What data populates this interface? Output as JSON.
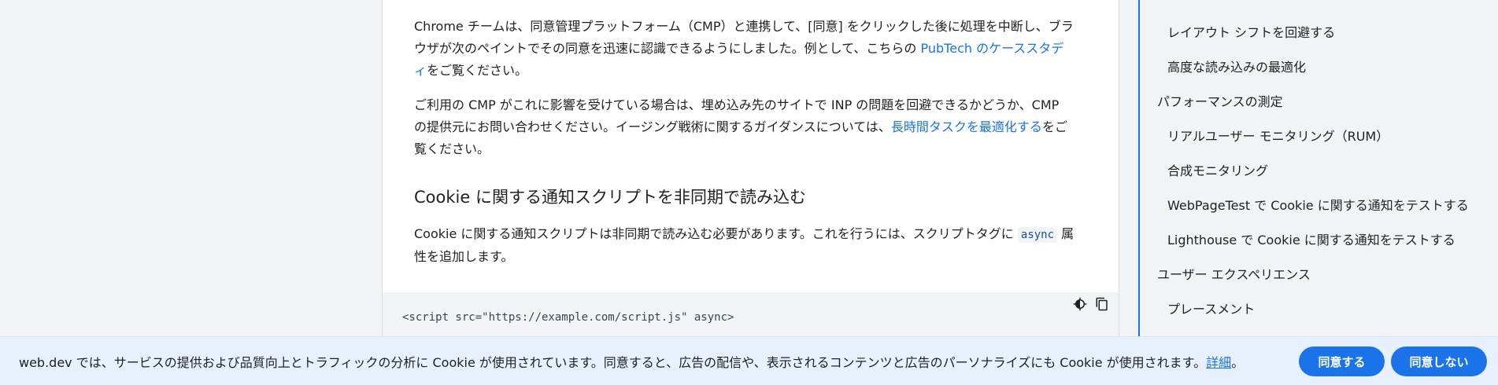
{
  "article": {
    "p1": {
      "text_before": "Chrome チームは、同意管理プラットフォーム（CMP）と連携して、[同意] をクリックした後に処理を中断し、ブラウザが次のペイントでその同意を迅速に認識できるようにしました。例として、こちらの ",
      "link": "PubTech のケーススタディ",
      "text_after": "をご覧ください。"
    },
    "p2": {
      "text_before": "ご利用の CMP がこれに影響を受けている場合は、埋め込み先のサイトで INP の問題を回避できるかどうか、CMP の提供元にお問い合わせください。イージング戦術に関するガイダンスについては、",
      "link": "長時間タスクを最適化する",
      "text_after": "をご覧ください。"
    },
    "heading": "Cookie に関する通知スクリプトを非同期で読み込む",
    "p3": {
      "text_before": "Cookie に関する通知スクリプトは非同期で読み込む必要があります。これを行うには、スクリプトタグに ",
      "code": "async",
      "text_after": " 属性を追加します。"
    },
    "code_block": {
      "line": "<script src=\"https://example.com/script.js\" async>",
      "icons": [
        "dark-theme-icon",
        "copy-icon"
      ]
    }
  },
  "toc": {
    "items": [
      {
        "label": "レイアウト シフトを回避する",
        "level": 2
      },
      {
        "label": "高度な読み込みの最適化",
        "level": 2
      },
      {
        "label": "パフォーマンスの測定",
        "level": 1
      },
      {
        "label": "リアルユーザー モニタリング（RUM）",
        "level": 2
      },
      {
        "label": "合成モニタリング",
        "level": 2
      },
      {
        "label": "WebPageTest で Cookie に関する通知をテストする",
        "level": 2
      },
      {
        "label": "Lighthouse で Cookie に関する通知をテストする",
        "level": 2
      },
      {
        "label": "ユーザー エクスペリエンス",
        "level": 1
      },
      {
        "label": "プレースメント",
        "level": 2
      }
    ]
  },
  "cookie_banner": {
    "text": "web.dev では、サービスの提供および品質向上とトラフィックの分析に Cookie が使用されています。同意すると、広告の配信や、表示されるコンテンツと広告のパーソナライズにも Cookie が使用されます。",
    "link": "詳細",
    "link_suffix": "。",
    "agree_label": "同意する",
    "disagree_label": "同意しない"
  },
  "colors": {
    "accent": "#1a73e8",
    "background": "#f1f3f4",
    "banner_background": "#e8f0fe"
  }
}
